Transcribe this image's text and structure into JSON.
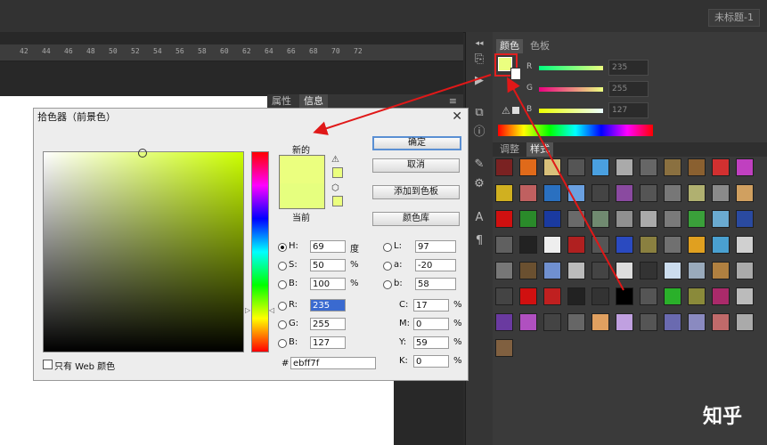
{
  "document": {
    "tab_label": "未标题-1"
  },
  "ruler": {
    "ticks": [
      "42",
      "44",
      "46",
      "48",
      "50",
      "52",
      "54",
      "56",
      "58",
      "60",
      "62",
      "64",
      "66",
      "68",
      "70",
      "72"
    ]
  },
  "props_tabs": {
    "properties": "属性",
    "info": "信息",
    "menu_icon": "panel-menu-icon"
  },
  "color_panel": {
    "tabs": {
      "color": "颜色",
      "swatches": "色板"
    },
    "fg_color": "#ebff7f",
    "sliders": [
      {
        "label": "R",
        "value": "235"
      },
      {
        "label": "G",
        "value": "255"
      },
      {
        "label": "B",
        "value": "127"
      }
    ]
  },
  "styles_panel": {
    "tabs": {
      "adjust": "调整",
      "styles": "样式"
    }
  },
  "dialog": {
    "title": "拾色器（前景色）",
    "new_label": "新的",
    "current_label": "当前",
    "buttons": {
      "ok": "确定",
      "cancel": "取消",
      "add_swatch": "添加到色板",
      "color_lib": "颜色库"
    },
    "hsb": [
      {
        "label": "H:",
        "value": "69",
        "unit": "度",
        "selected": true
      },
      {
        "label": "S:",
        "value": "50",
        "unit": "%",
        "selected": false
      },
      {
        "label": "B:",
        "value": "100",
        "unit": "%",
        "selected": false
      }
    ],
    "rgb": [
      {
        "label": "R:",
        "value": "235"
      },
      {
        "label": "G:",
        "value": "255"
      },
      {
        "label": "B:",
        "value": "127"
      }
    ],
    "lab": [
      {
        "label": "L:",
        "value": "97"
      },
      {
        "label": "a:",
        "value": "-20"
      },
      {
        "label": "b:",
        "value": "58"
      }
    ],
    "cmyk": [
      {
        "label": "C:",
        "value": "17",
        "unit": "%"
      },
      {
        "label": "M:",
        "value": "0",
        "unit": "%"
      },
      {
        "label": "Y:",
        "value": "59",
        "unit": "%"
      },
      {
        "label": "K:",
        "value": "0",
        "unit": "%"
      }
    ],
    "hex_label": "#",
    "hex_value": "ebff7f",
    "web_only_label": "只有 Web 颜色"
  },
  "watermark": "知乎"
}
